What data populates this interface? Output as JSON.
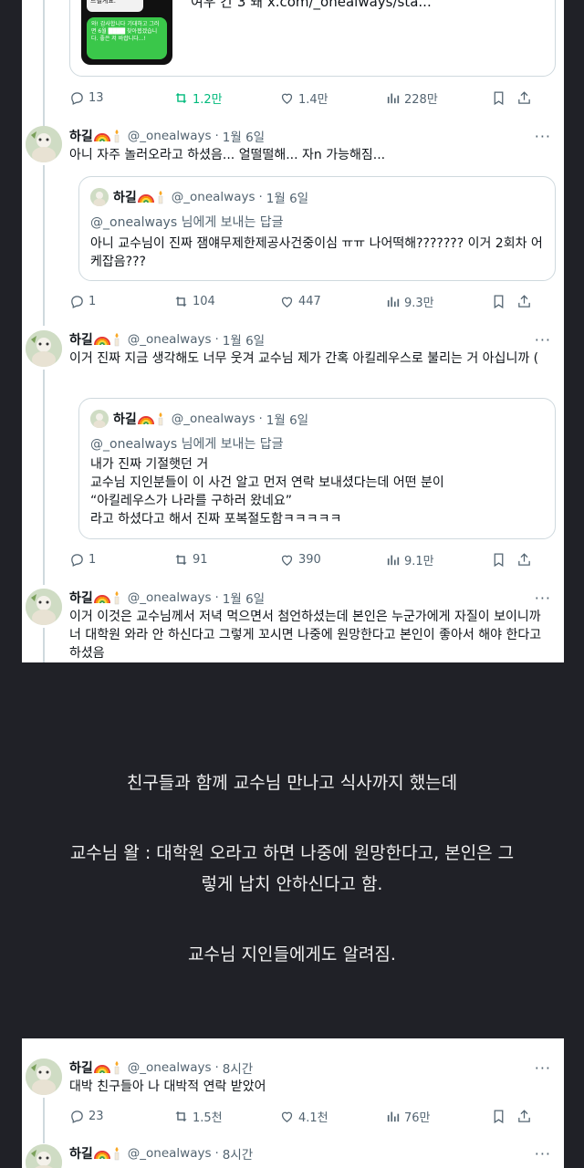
{
  "colors": {
    "page_background": "#202127",
    "panel_background": "#ffffff",
    "text_primary": "#0f1419",
    "text_secondary": "#536471",
    "border": "#cfd9de"
  },
  "top_fragment": {
    "link_text": "여우 간 3 돼 x.com/_onealways/sta...",
    "bubble_white_text": "드릴게요.",
    "bubble_green_text": "와! 감사합니다 기대하고 그러면 6월 ████ 찾아뵙겠습니다. 좋은 저 바랍니다...!",
    "actions": {
      "replies": "13",
      "retweets": "1.2만",
      "likes": "1.4만",
      "views": "228만"
    }
  },
  "tweets": [
    {
      "name": "하길",
      "handle": "@_onealways",
      "time": "1월 6일",
      "text": "아니 자주 놀러오라고 하셨음... 얼떨떨해... 자n 가능해짐...",
      "quote": {
        "name": "하길",
        "handle": "@_onealways",
        "time": "1월 6일",
        "reply_mention": "@_onealways",
        "reply_suffix": " 님에게 보내는 답글",
        "text": "아니 교수님이 진짜 잼얘무제한제공사건중이심 ㅠㅠ 나어떡해??????? 이거 2회차 어케잡음???"
      },
      "actions": {
        "replies": "1",
        "retweets": "104",
        "likes": "447",
        "views": "9.3만"
      }
    },
    {
      "name": "하길",
      "handle": "@_onealways",
      "time": "1월 6일",
      "text": "이거 진짜 지금 생각해도 너무 웃겨 교수님 제가 간혹 아킬레우스로 불리는 거 아십니까 (",
      "quote": {
        "name": "하길",
        "handle": "@_onealways",
        "time": "1월 6일",
        "reply_mention": "@_onealways",
        "reply_suffix": " 님에게 보내는 답글",
        "text": "내가 진짜 기절햇던 거\n교수님 지인분들이 이 사건 알고 먼저 연락 보내셨다는데 어떤 분이\n“아킬레우스가 나라를 구하러 왔네요”\n라고 하셨다고 해서 진짜 포복절도함ㅋㅋㅋㅋㅋ"
      },
      "actions": {
        "replies": "1",
        "retweets": "91",
        "likes": "390",
        "views": "9.1만"
      }
    },
    {
      "name": "하길",
      "handle": "@_onealways",
      "time": "1월 6일",
      "text": "이거 이것은 교수님께서 저녁 먹으면서 첨언하셨는데 본인은 누군가에게 자질이 보이니까 너 대학원 와라 안 하신다고 그렇게 꼬시면 나중에 원망한다고 본인이 좋아서 해야 한다고 하셨음"
    }
  ],
  "commentary": {
    "line1": "친구들과 함께 교수님 만나고 식사까지 했는데",
    "line2": "교수님 왈 : 대학원 오라고 하면 나중에 원망한다고, 본인은 그",
    "line3": "렇게 납치 안하신다고 함.",
    "line4": "교수님 지인들에게도 알려짐."
  },
  "bottom_tweets": [
    {
      "name": "하길",
      "handle": "@_onealways",
      "time": "8시간",
      "text": "대박 친구들아 나 대박적 연락 받았어",
      "actions": {
        "replies": "23",
        "retweets": "1.5천",
        "likes": "4.1천",
        "views": "76만"
      }
    },
    {
      "name": "하길",
      "handle": "@_onealways",
      "time": "8시간",
      "text": ""
    }
  ]
}
